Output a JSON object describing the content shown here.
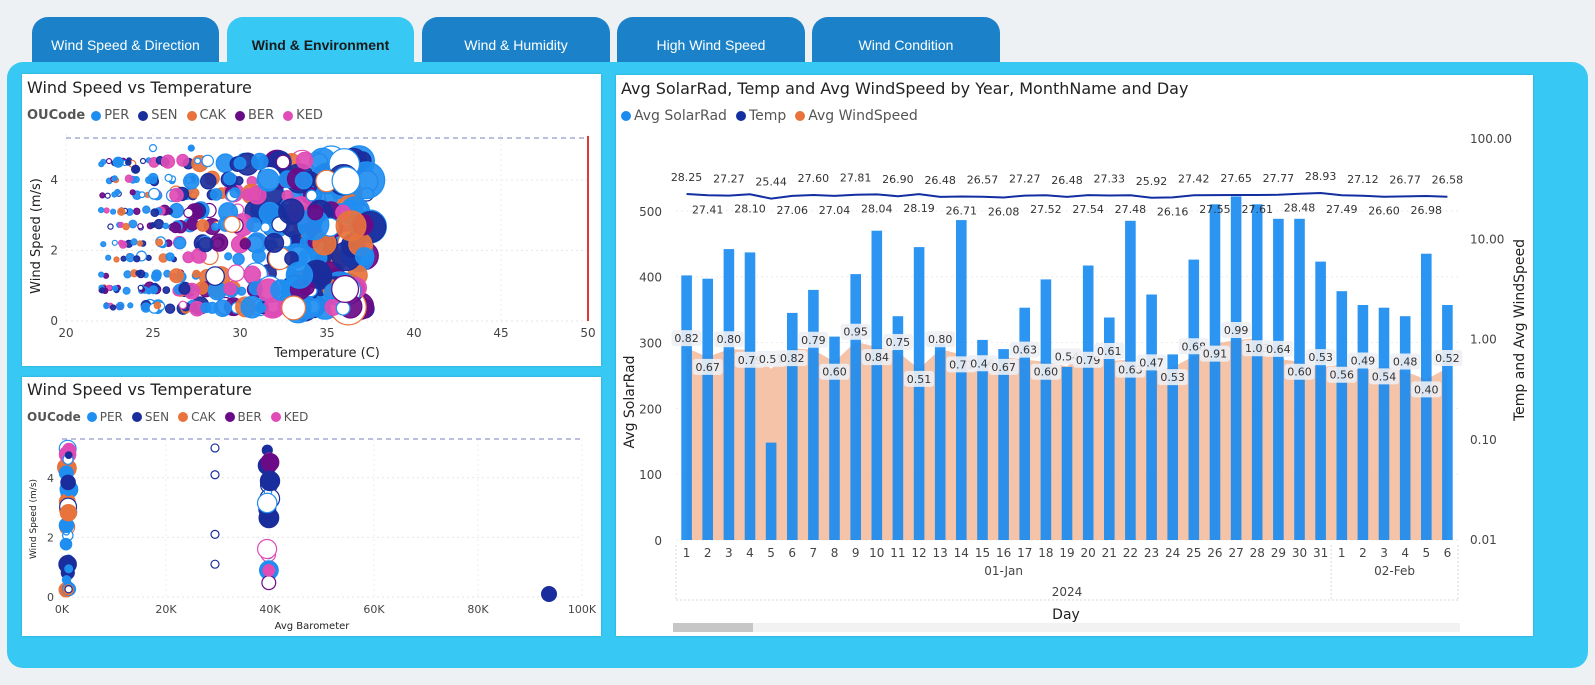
{
  "tabs": [
    {
      "label": "Wind Speed & Direction",
      "active": false
    },
    {
      "label": "Wind & Environment",
      "active": true
    },
    {
      "label": "Wind & Humidity",
      "active": false
    },
    {
      "label": "High Wind Speed",
      "active": false
    },
    {
      "label": "Wind Condition",
      "active": false
    }
  ],
  "legend_codes": {
    "title": "OUCode",
    "items": [
      {
        "label": "PER",
        "color": "#1f8ef1"
      },
      {
        "label": "SEN",
        "color": "#1a2d9c"
      },
      {
        "label": "CAK",
        "color": "#e8733c"
      },
      {
        "label": "BER",
        "color": "#6b0a86"
      },
      {
        "label": "KED",
        "color": "#e04bb5"
      }
    ]
  },
  "scatter1": {
    "title": "Wind Speed vs Temperature",
    "xlabel": "Temperature (C)",
    "ylabel": "Wind Speed (m/s)",
    "xticks": [
      "20",
      "25",
      "30",
      "35",
      "40",
      "45",
      "50"
    ],
    "yticks": [
      "0",
      "2",
      "4"
    ]
  },
  "scatter2": {
    "title": "Wind Speed vs Temperature",
    "xlabel": "Avg Barometer",
    "ylabel": "Wind Speed (m/s)",
    "xticks": [
      "0K",
      "20K",
      "40K",
      "60K",
      "80K",
      "100K"
    ],
    "yticks": [
      "0",
      "2",
      "4"
    ]
  },
  "chart_data": [
    {
      "type": "scatter",
      "title": "Wind Speed vs Temperature",
      "xlabel": "Temperature (C)",
      "ylabel": "Wind Speed (m/s)",
      "xlim": [
        20,
        50
      ],
      "ylim": [
        0,
        5
      ],
      "reference_lines": {
        "y": 5,
        "x": 50
      },
      "series": [
        {
          "name": "PER"
        },
        {
          "name": "SEN"
        },
        {
          "name": "CAK"
        },
        {
          "name": "BER"
        },
        {
          "name": "KED"
        }
      ]
    },
    {
      "type": "scatter",
      "title": "Wind Speed vs Temperature",
      "xlabel": "Avg Barometer",
      "ylabel": "Wind Speed (m/s)",
      "xlim": [
        0,
        100000
      ],
      "ylim": [
        0,
        5
      ],
      "series": [
        {
          "name": "PER"
        },
        {
          "name": "SEN"
        },
        {
          "name": "CAK"
        },
        {
          "name": "BER"
        },
        {
          "name": "KED"
        }
      ]
    },
    {
      "type": "bar",
      "title": "Avg SolarRad, Temp and Avg WindSpeed by Year, MonthName and Day",
      "xlabel": "Day",
      "ylabel": "Avg SolarRad",
      "y2label": "Temp and Avg WindSpeed",
      "ylim": [
        0,
        550
      ],
      "yticks": [
        "0",
        "100",
        "200",
        "300",
        "400",
        "500"
      ],
      "y2_scale": "log",
      "y2ticks": [
        "0.01",
        "0.10",
        "1.00",
        "10.00",
        "100.00"
      ],
      "legend": [
        {
          "label": "Avg SolarRad",
          "color": "#1a8cf0"
        },
        {
          "label": "Temp",
          "color": "#132ea0"
        },
        {
          "label": "Avg WindSpeed",
          "color": "#e8733c"
        }
      ],
      "categories": [
        "1",
        "2",
        "3",
        "4",
        "5",
        "6",
        "7",
        "8",
        "9",
        "10",
        "11",
        "12",
        "13",
        "14",
        "15",
        "16",
        "17",
        "18",
        "19",
        "20",
        "21",
        "22",
        "23",
        "24",
        "25",
        "26",
        "27",
        "28",
        "29",
        "30",
        "31",
        "1",
        "2",
        "3",
        "4",
        "5",
        "6"
      ],
      "months": [
        {
          "label": "01-Jan",
          "from": 0,
          "to": 30
        },
        {
          "label": "02-Feb",
          "from": 31,
          "to": 36
        }
      ],
      "year": "2024",
      "series": [
        {
          "name": "Avg SolarRad",
          "values": [
            402,
            397,
            442,
            437,
            148,
            345,
            380,
            309,
            404,
            470,
            340,
            445,
            298,
            486,
            304,
            290,
            353,
            396,
            263,
            417,
            338,
            485,
            373,
            282,
            426,
            510,
            522,
            510,
            488,
            488,
            423,
            378,
            357,
            353,
            340,
            435,
            357
          ]
        },
        {
          "name": "Temp",
          "values": [
            28.25,
            27.41,
            27.27,
            28.1,
            25.44,
            27.06,
            27.6,
            27.04,
            27.81,
            28.04,
            26.9,
            28.19,
            26.48,
            26.71,
            26.57,
            26.08,
            27.27,
            27.52,
            26.48,
            27.54,
            27.33,
            27.48,
            25.92,
            26.16,
            27.42,
            27.55,
            27.65,
            27.61,
            27.77,
            28.48,
            28.93,
            27.49,
            27.12,
            26.6,
            26.77,
            26.98,
            26.58
          ]
        },
        {
          "name": "Avg WindSpeed",
          "values": [
            0.82,
            0.67,
            0.8,
            0.79,
            0.51,
            0.82,
            0.79,
            0.6,
            0.95,
            0.84,
            0.75,
            0.51,
            0.8,
            0.71,
            0.46,
            0.67,
            0.63,
            0.6,
            0.54,
            0.79,
            0.61,
            0.63,
            0.47,
            0.53,
            0.68,
            0.91,
            0.99,
            1.03,
            0.64,
            0.6,
            0.53,
            0.56,
            0.49,
            0.54,
            0.48,
            0.4,
            0.52
          ]
        }
      ]
    }
  ]
}
